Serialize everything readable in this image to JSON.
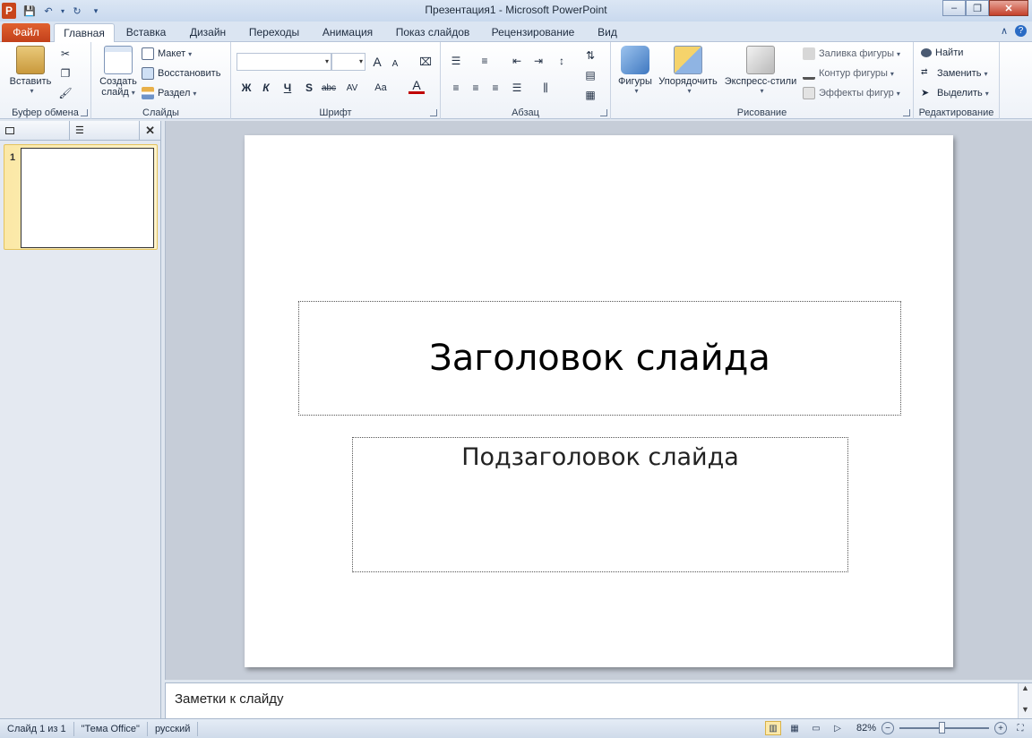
{
  "window": {
    "title": "Презентация1 - Microsoft PowerPoint",
    "app_icon": "P",
    "minimize_icon": "minimize-icon",
    "maximize_icon": "restore-icon",
    "close_icon": "close-icon"
  },
  "quick_access": [
    "save-icon",
    "undo-icon",
    "redo-icon",
    "customize-icon"
  ],
  "tabs": {
    "file": "Файл",
    "items": [
      "Главная",
      "Вставка",
      "Дизайн",
      "Переходы",
      "Анимация",
      "Показ слайдов",
      "Рецензирование",
      "Вид"
    ],
    "active": "Главная"
  },
  "ribbon": {
    "clipboard": {
      "label": "Буфер обмена",
      "paste": "Вставить"
    },
    "slides": {
      "label": "Слайды",
      "new_slide_line1": "Создать",
      "new_slide_line2": "слайд",
      "layout": "Макет",
      "reset": "Восстановить",
      "section": "Раздел"
    },
    "font": {
      "label": "Шрифт",
      "font_name": "",
      "font_size": "",
      "bold": "Ж",
      "italic": "К",
      "underline": "Ч",
      "shadow": "S",
      "strike": "abc",
      "spacing": "AV",
      "case": "Aa",
      "color": "A",
      "grow": "A",
      "shrink": "A"
    },
    "paragraph": {
      "label": "Абзац"
    },
    "drawing": {
      "label": "Рисование",
      "shapes": "Фигуры",
      "arrange": "Упорядочить",
      "quick_styles": "Экспресс-стили",
      "shape_fill": "Заливка фигуры",
      "shape_outline": "Контур фигуры",
      "shape_effects": "Эффекты фигур"
    },
    "editing": {
      "label": "Редактирование",
      "find": "Найти",
      "replace": "Заменить",
      "select": "Выделить"
    }
  },
  "left_panel": {
    "slide_number": "1"
  },
  "slide": {
    "title": "Заголовок слайда",
    "subtitle": "Подзаголовок слайда"
  },
  "notes": {
    "placeholder": "Заметки к слайду"
  },
  "status_bar": {
    "slide_info": "Слайд 1 из 1",
    "theme": "\"Тема Office\"",
    "language": "русский",
    "zoom": "82%",
    "zoom_out": "−",
    "zoom_in": "+"
  }
}
